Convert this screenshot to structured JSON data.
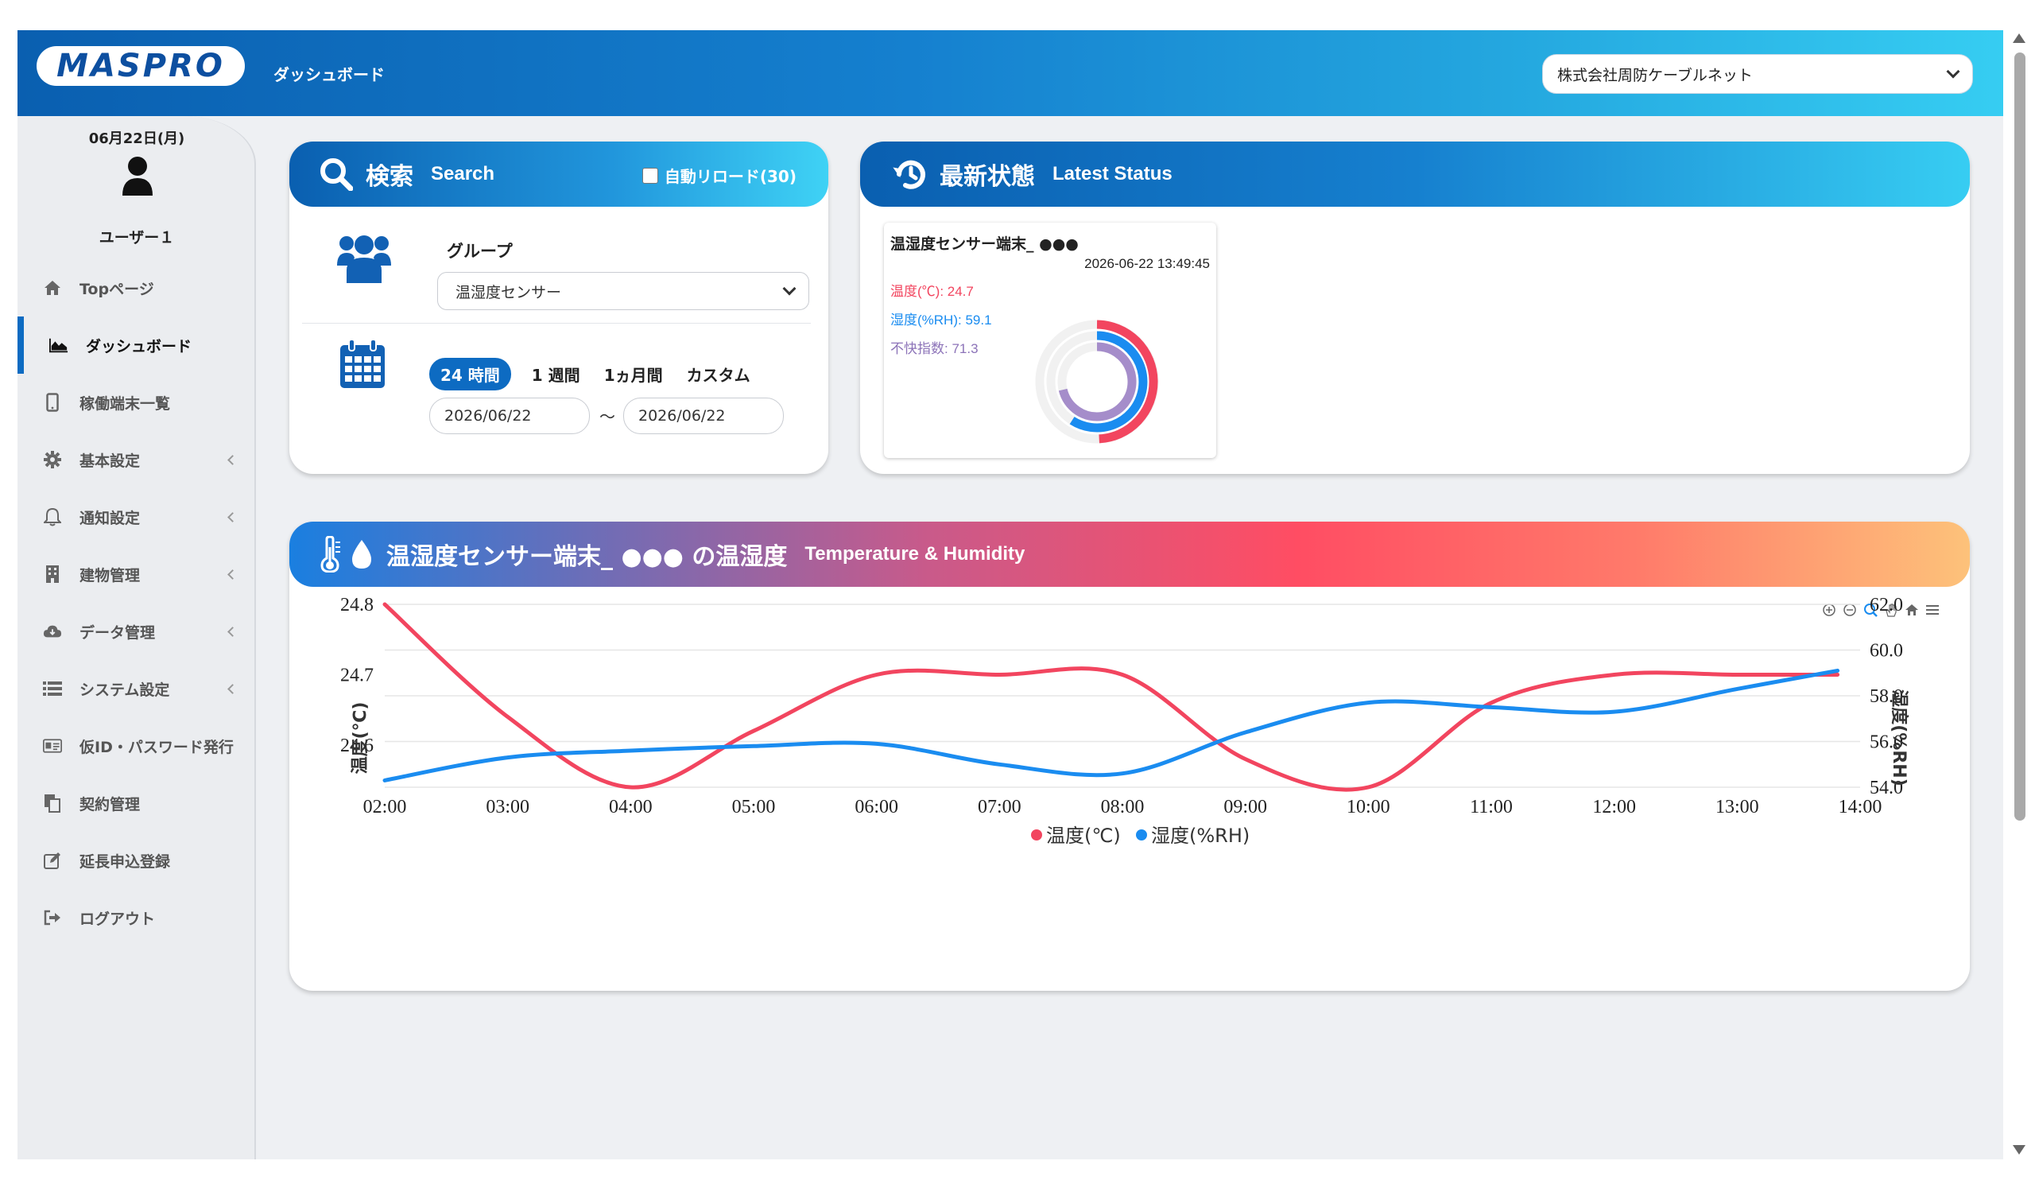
{
  "header": {
    "logo_text": "MASPRO",
    "title": "ダッシュボード",
    "company": "株式会社周防ケーブルネット"
  },
  "sidebar": {
    "date": "06月22日(月)",
    "user": "ユーザー１",
    "items": [
      {
        "label": "Topページ",
        "icon": "home-icon"
      },
      {
        "label": "ダッシュボード",
        "icon": "area-chart-icon"
      },
      {
        "label": "稼働端末一覧",
        "icon": "mobile-icon"
      },
      {
        "label": "基本設定",
        "icon": "gear-icon"
      },
      {
        "label": "通知設定",
        "icon": "bell-icon"
      },
      {
        "label": "建物管理",
        "icon": "building-icon"
      },
      {
        "label": "データ管理",
        "icon": "cloud-download-icon"
      },
      {
        "label": "システム設定",
        "icon": "list-icon"
      },
      {
        "label": "仮ID・パスワード発行",
        "icon": "id-card-icon"
      },
      {
        "label": "契約管理",
        "icon": "copy-icon"
      },
      {
        "label": "延長申込登録",
        "icon": "edit-icon"
      },
      {
        "label": "ログアウト",
        "icon": "sign-out-icon"
      }
    ]
  },
  "search": {
    "title": "検索",
    "subtitle": "Search",
    "auto_reload": "自動リロード(30)",
    "group_label": "グループ",
    "group_value": "温湿度センサー",
    "periods": [
      "24 時間",
      "1 週間",
      "1ヵ月間",
      "カスタム"
    ],
    "date_from": "2026/06/22",
    "date_to": "2026/06/22",
    "tilde": "〜"
  },
  "status": {
    "title": "最新状態",
    "subtitle": "Latest Status",
    "device_name": "温湿度センサー端末_ ●●●",
    "timestamp": "2026-06-22 13:49:45",
    "temp_text": "温度(℃): 24.7",
    "humidity_text": "湿度(%RH): 59.1",
    "discomfort_text": "不快指数: 71.3",
    "temp": 24.7,
    "humidity": 59.1,
    "discomfort": 71.3
  },
  "chart_card": {
    "title": "温湿度センサー端末_ ●●● の温湿度",
    "subtitle": "Temperature & Humidity"
  },
  "colors": {
    "temperature": "#f2455f",
    "humidity": "#1a8cf0",
    "discomfort": "#a58dca"
  },
  "chart_data": {
    "type": "line",
    "x": [
      "02:00",
      "03:00",
      "04:00",
      "05:00",
      "06:00",
      "07:00",
      "08:00",
      "09:00",
      "10:00",
      "11:00",
      "12:00",
      "13:00",
      "14:00"
    ],
    "ylabel": "温度(℃)",
    "y2label": "湿度(%RH)",
    "ylim": [
      24.54,
      24.8
    ],
    "y_ticks": [
      "24.8",
      "24.7",
      "24.6"
    ],
    "y2lim": [
      54.0,
      62.0
    ],
    "y2_ticks": [
      "62.0",
      "60.0",
      "58.0",
      "56.0",
      "54.0"
    ],
    "legend_position": "bottom",
    "series": [
      {
        "name": "温度(℃)",
        "axis": "left",
        "x": [
          "02:00",
          "03:00",
          "04:00",
          "05:00",
          "06:00",
          "07:00",
          "08:00",
          "09:00",
          "10:00",
          "11:00",
          "12:00",
          "13:00",
          "13:49"
        ],
        "values": [
          24.8,
          24.64,
          24.54,
          24.62,
          24.7,
          24.7,
          24.7,
          24.58,
          24.54,
          24.66,
          24.7,
          24.7,
          24.7
        ]
      },
      {
        "name": "湿度(%RH)",
        "axis": "right",
        "x": [
          "02:00",
          "03:00",
          "04:00",
          "05:00",
          "06:00",
          "07:00",
          "08:00",
          "09:00",
          "10:00",
          "11:00",
          "12:00",
          "13:00",
          "13:49"
        ],
        "values": [
          54.3,
          55.3,
          55.6,
          55.8,
          55.9,
          55.0,
          54.6,
          56.4,
          57.7,
          57.5,
          57.3,
          58.3,
          59.1
        ]
      }
    ]
  }
}
